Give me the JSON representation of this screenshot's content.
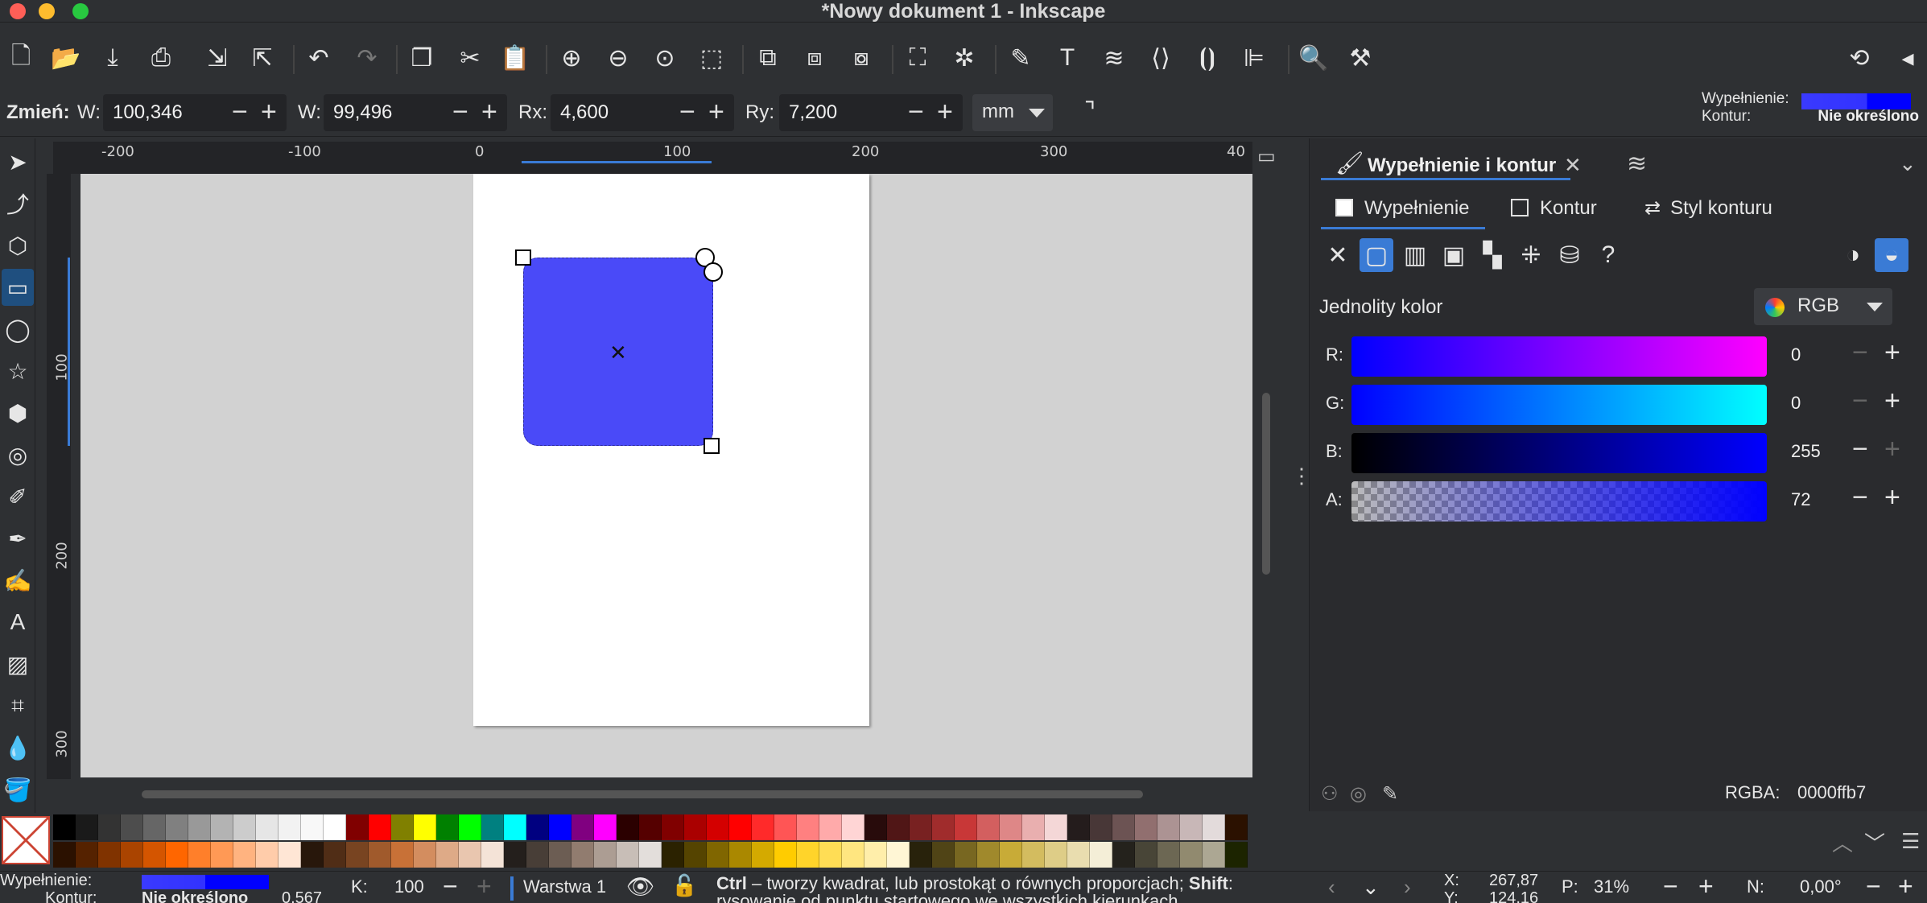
{
  "window": {
    "title": "*Nowy dokument 1 - Inkscape"
  },
  "toolbar": {
    "icons": [
      "new-document",
      "open",
      "import",
      "print",
      "export-doc",
      "export",
      "undo",
      "redo",
      "duplicate",
      "cut",
      "paste",
      "zoom-selection",
      "zoom-drawing",
      "zoom-page",
      "zoom-fit",
      "group",
      "lock-a",
      "lock-b",
      "align-a",
      "align-b",
      "fill-stroke",
      "text",
      "layers",
      "xml-editor",
      "objects",
      "align-distribute",
      "find",
      "preferences",
      "rotate",
      "sidebar"
    ]
  },
  "controls": {
    "label": "Zmień:",
    "w_label": "W:",
    "w_value": "100,346",
    "h_label": "W:",
    "h_value": "99,496",
    "rx_label": "Rx:",
    "rx_value": "4,600",
    "ry_label": "Ry:",
    "ry_value": "7,200",
    "unit": "mm"
  },
  "fill_indicator": {
    "fill_label": "Wypełnienie:",
    "stroke_label": "Kontur:",
    "stroke_value": "Nie określono",
    "fill_color": "#0000ff"
  },
  "rulers": {
    "h_ticks": [
      "-200",
      "-100",
      "0",
      "100",
      "200",
      "300",
      "40"
    ],
    "v_ticks": [
      "100",
      "200",
      "300"
    ]
  },
  "dock": {
    "title": "Wypełnienie i kontur",
    "tabs": [
      "Wypełnienie",
      "Kontur",
      "Styl konturu"
    ],
    "flat_label": "Jednolity kolor",
    "mode": "RGB",
    "channels": [
      {
        "label": "R:",
        "value": "0"
      },
      {
        "label": "G:",
        "value": "0"
      },
      {
        "label": "B:",
        "value": "255"
      },
      {
        "label": "A:",
        "value": "72"
      }
    ],
    "rgba_label": "RGBA:",
    "rgba_value": "0000ffb7"
  },
  "status": {
    "fill_label": "Wypełnienie:",
    "stroke_label": "Kontur:",
    "stroke_value": "Nie określono",
    "stroke_width": "0,567",
    "opacity_label": "K:",
    "opacity_value": "100",
    "layer": "Warstwa 1",
    "hint_ctrl": "Ctrl",
    "hint_line1": " – tworzy kwadrat, lub prostokąt o równych proporcjach; ",
    "hint_shift": "Shift",
    "hint_colon": ":",
    "hint_line2": "rysowanie od punktu startowego we wszystkich kierunkach",
    "x_label": "X:",
    "x_value": "267,87",
    "y_label": "Y:",
    "y_value": "124,16",
    "zoom_label": "P:",
    "zoom_value": "31%",
    "rot_label": "N:",
    "rot_value": "0,00°"
  },
  "palette": {
    "row1": [
      "#000000",
      "#1a1a1a",
      "#333333",
      "#4d4d4d",
      "#666666",
      "#808080",
      "#999999",
      "#b3b3b3",
      "#cccccc",
      "#e6e6e6",
      "#f2f2f2",
      "#f8f8f8",
      "#ffffff",
      "#800000",
      "#ff0000",
      "#808000",
      "#ffff00",
      "#008000",
      "#00ff00",
      "#008080",
      "#00ffff",
      "#000080",
      "#0000ff",
      "#800080",
      "#ff00ff",
      "#2b0000",
      "#550000",
      "#800000",
      "#aa0000",
      "#d40000",
      "#ff0000",
      "#ff2a2a",
      "#ff5555",
      "#ff8080",
      "#ffaaaa",
      "#ffd5d5",
      "#280b0b",
      "#501616",
      "#782121",
      "#a02c2c",
      "#c83737",
      "#d35f5f",
      "#de8787",
      "#e9afaf",
      "#f4d7d7",
      "#241c1c",
      "#483737",
      "#6c5353",
      "#916f6f",
      "#ac9393",
      "#c8b7b7",
      "#e3dbdb",
      "#2b1100"
    ],
    "row2": [
      "#2b1100",
      "#552200",
      "#803300",
      "#aa4400",
      "#d45500",
      "#ff6600",
      "#ff7f2a",
      "#ff9955",
      "#ffb380",
      "#ffccaa",
      "#ffe6d5",
      "#28170b",
      "#502d16",
      "#784421",
      "#a05a2c",
      "#c87137",
      "#d38d5f",
      "#deaa87",
      "#e9c6af",
      "#f4e3d7",
      "#241f1c",
      "#483e37",
      "#6c5d53",
      "#917c6f",
      "#ac9d93",
      "#c8beb7",
      "#e3dedb",
      "#2b2200",
      "#554400",
      "#806600",
      "#aa8800",
      "#d4aa00",
      "#ffcc00",
      "#ffd42a",
      "#ffdd55",
      "#ffe680",
      "#ffeeaa",
      "#fff6d5",
      "#28220b",
      "#504416",
      "#786721",
      "#a0892c",
      "#c8ab37",
      "#d3bc5f",
      "#decd87",
      "#e9ddaf",
      "#f4eed7",
      "#24221c",
      "#484537",
      "#6c6753",
      "#918a6f",
      "#aca793",
      "#1c2400"
    ]
  }
}
